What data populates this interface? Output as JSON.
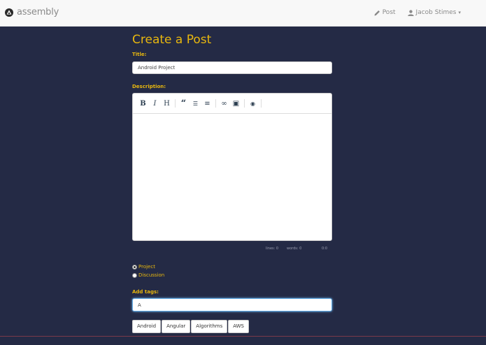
{
  "navbar": {
    "brand": "assembly",
    "post_link": "Post",
    "user_name": "Jacob Stimes",
    "user_caret": "▾"
  },
  "form": {
    "title": "Create a Post",
    "title_label": "Title:",
    "title_value": "Android Project",
    "description_label": "Description:",
    "toolbar": [
      {
        "name": "bold",
        "glyph": "B"
      },
      {
        "name": "italic",
        "glyph": "I"
      },
      {
        "name": "heading",
        "glyph": "H"
      },
      {
        "name": "quote",
        "glyph": "“"
      },
      {
        "name": "unordered-list",
        "glyph": "☰"
      },
      {
        "name": "ordered-list",
        "glyph": "≡"
      },
      {
        "name": "link",
        "glyph": "∞"
      },
      {
        "name": "image",
        "glyph": "▣"
      },
      {
        "name": "preview",
        "glyph": "◉"
      }
    ],
    "status": {
      "lines": "lines: 0",
      "words": "words: 0",
      "cursor": "0:0"
    },
    "post_types": [
      {
        "label": "Project",
        "checked": true
      },
      {
        "label": "Discussion",
        "checked": false
      }
    ],
    "tags_label": "Add tags:",
    "tags_value": "A",
    "tag_suggestions": [
      "Android",
      "Angular",
      "Algorithms",
      "AWS"
    ]
  },
  "colors": {
    "background": "#242a45",
    "accent": "#e8b70e"
  }
}
